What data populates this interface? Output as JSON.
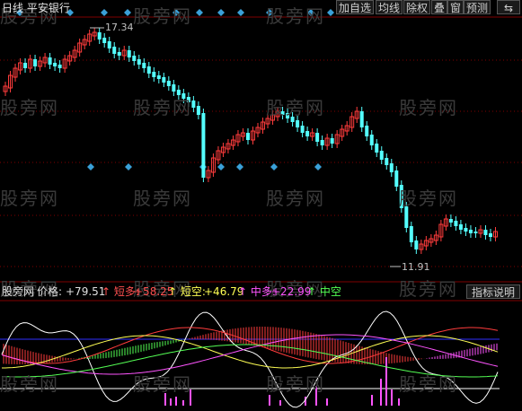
{
  "header": {
    "title": "日线  平安银行",
    "buttons": [
      "加自选",
      "均线",
      "除权",
      "叠",
      "窗",
      "预测"
    ],
    "swap_icon": "swap-icon"
  },
  "price_chart": {
    "high_label": "17.34",
    "low_label": "11.91"
  },
  "indicator": {
    "name_label": "股旁网",
    "price_label": "价格:",
    "price_value": "+79.51",
    "short_long_label": "短多:",
    "short_long_value": "+58.25",
    "short_short_label": "短空:",
    "short_short_value": "+46.79",
    "mid_long_label": "中多:",
    "mid_long_value": "+22.99",
    "mid_short_label": "中空",
    "help_button": "指标说明"
  },
  "watermark": "股旁网",
  "colors": {
    "bg": "#000000",
    "up": "#ff3c3c",
    "down": "#54ffff",
    "diamond": "#3aa0d8",
    "yellow": "#ffff54",
    "magenta": "#ff54ff",
    "green": "#54ff54",
    "grid": "#800000"
  }
}
